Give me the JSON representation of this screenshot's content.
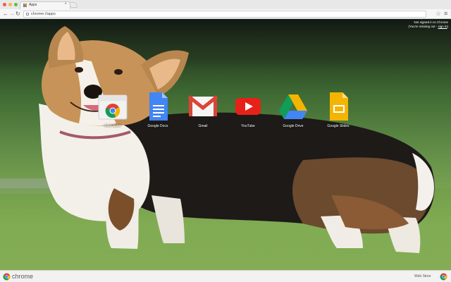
{
  "window": {
    "tab_title": "Apps",
    "tab_close": "×",
    "traffic_lights": [
      "#ee5b50",
      "#f4b63f",
      "#56c24a"
    ]
  },
  "toolbar": {
    "back": "←",
    "forward": "→",
    "reload": "↻",
    "url": "chrome://apps",
    "star": "☆",
    "menu": "≡"
  },
  "signin": {
    "line1": "Not signed in to Chrome",
    "line2_prefix": "(You're missing out - ",
    "line2_link": "sign in",
    "line2_suffix": ")"
  },
  "apps": [
    {
      "label": "Web Store",
      "icon": "web-store-icon"
    },
    {
      "label": "Google Docs",
      "icon": "google-docs-icon"
    },
    {
      "label": "Gmail",
      "icon": "gmail-icon"
    },
    {
      "label": "YouTube",
      "icon": "youtube-icon"
    },
    {
      "label": "Google Drive",
      "icon": "google-drive-icon"
    },
    {
      "label": "Google Slides",
      "icon": "google-slides-icon"
    }
  ],
  "bottombar": {
    "brand": "chrome",
    "webstore": "Web Store"
  },
  "colors": {
    "chrome_red": "#db4437",
    "chrome_green": "#0f9d58",
    "chrome_yellow": "#f4b400",
    "chrome_blue": "#4285f4"
  }
}
